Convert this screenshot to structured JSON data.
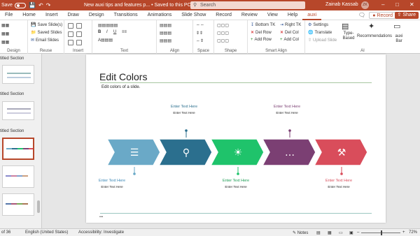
{
  "titlebar": {
    "autosave_label": "Save",
    "doc_title": "New auxi tips and features p... • Saved to this PC ⌄",
    "search_placeholder": "Search",
    "user_name": "Zainab Kassab",
    "user_initials": "ZK",
    "minimize": "–",
    "maximize": "□",
    "close": "✕"
  },
  "tabs": [
    "File",
    "Home",
    "Insert",
    "Draw",
    "Design",
    "Transitions",
    "Animations",
    "Slide Show",
    "Record",
    "Review",
    "View",
    "Help",
    "auxi"
  ],
  "active_tab": "auxi",
  "tabbar": {
    "comment_icon": "comment-icon",
    "record_label": "Record",
    "share_label": "Share"
  },
  "ribbon": {
    "reuse": {
      "items": [
        "Save Slide(s)",
        "Saved Slides",
        "Email Slides"
      ],
      "label": "Reuse"
    },
    "insert_label": "Insert",
    "text_label": "Text",
    "align_label": "Align",
    "space_label": "Space",
    "shape_label": "Shape",
    "smart_align": {
      "items": [
        "Bottom TK",
        "Right TK",
        "Del Row",
        "Del Col",
        "Add Row",
        "Add Col"
      ],
      "label": "Smart Align"
    },
    "ai": {
      "settings": "Settings",
      "translate": "Translate",
      "upload": "Upload Slide",
      "type_based": "Type-Based",
      "recommendations": "Recommendations",
      "auxi_bar": "auxi Bar",
      "label": "AI"
    },
    "left_label": "Design"
  },
  "sidebar": {
    "sections": [
      "titled Section",
      "titled Section",
      "titled Section"
    ]
  },
  "slide": {
    "title": "Edit Colors",
    "subtitle": "Edit colors of a slide.",
    "footer_dots": "•••",
    "steps": [
      {
        "color": "#6aa9c7",
        "icon": "document-icon",
        "label": "Enter Text Here",
        "sub": "Enter Text Here",
        "label_color": "#3a86b5",
        "position": "bottom"
      },
      {
        "color": "#2b6f8e",
        "icon": "search-icon",
        "label": "Enter Text Here",
        "sub": "Enter Text Here",
        "label_color": "#2b6f8e",
        "position": "top"
      },
      {
        "color": "#1fc36b",
        "icon": "lightbulb-icon",
        "label": "Enter Text Here",
        "sub": "Enter Text Here",
        "label_color": "#1a9b52",
        "position": "bottom"
      },
      {
        "color": "#7b3f73",
        "icon": "chat-icon",
        "label": "Enter Text Here",
        "sub": "Enter Text Here",
        "label_color": "#7b3f73",
        "position": "top"
      },
      {
        "color": "#d94d5b",
        "icon": "gavel-icon",
        "label": "Enter Text Here",
        "sub": "Enter Text Here",
        "label_color": "#d94d5b",
        "position": "bottom"
      }
    ]
  },
  "statusbar": {
    "slide_counter": "of 36",
    "language": "English (United States)",
    "accessibility": "Accessibility: Investigate",
    "notes": "Notes",
    "zoom": "72%"
  }
}
